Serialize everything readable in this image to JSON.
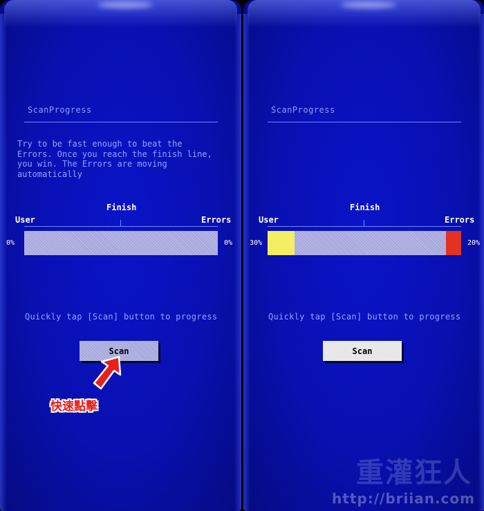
{
  "colors": {
    "panel_bg": "#0810b0",
    "text_blue": "#8ea4ff",
    "rule_blue": "#6f86ff",
    "bar_track": "#a7a7df",
    "user_fill": "#f4ef62",
    "errors_fill": "#e3321f",
    "annotation_red": "#e8201a"
  },
  "left": {
    "title": "ScanProgress",
    "instructions": "Try to be fast enough to beat the\nErrors. Once you reach the finish line,\nyou win. The Errors are moving\nautomatically",
    "finish_label": "Finish",
    "user_label": "User",
    "errors_label": "Errors",
    "user_pct": "0%",
    "errors_pct": "0%",
    "user_progress": 0,
    "errors_progress": 0,
    "hint": "Quickly tap [Scan] button to progress",
    "scan_label": "Scan",
    "annotation": "快速點擊",
    "annotation_icon": "red-arrow-icon"
  },
  "right": {
    "title": "ScanProgress",
    "finish_label": "Finish",
    "user_label": "User",
    "errors_label": "Errors",
    "user_pct": "30%",
    "errors_pct": "20%",
    "user_progress": 0.14,
    "errors_progress": 0.08,
    "hint": "Quickly tap [Scan] button to progress",
    "scan_label": "Scan",
    "watermark": "重灌狂人",
    "watermark_url": "http://briian.com"
  }
}
